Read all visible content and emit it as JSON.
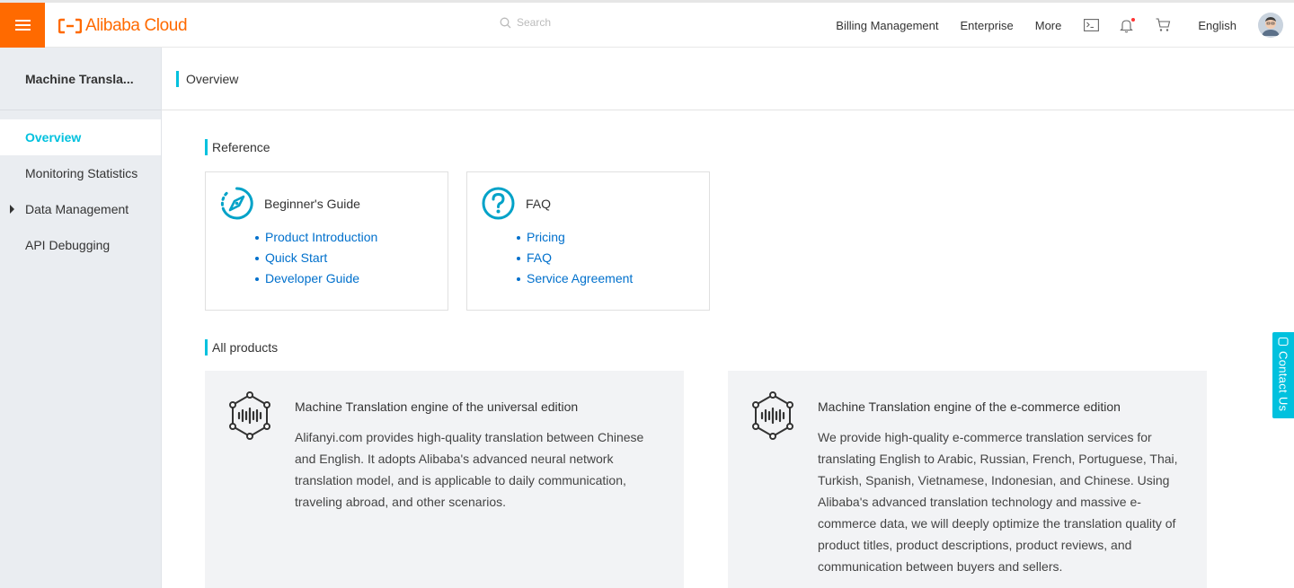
{
  "header": {
    "logo_text": "Alibaba Cloud",
    "search_placeholder": "Search",
    "links": [
      "Billing Management",
      "Enterprise",
      "More"
    ],
    "language": "English",
    "brand_color": "#ff6a00"
  },
  "sidebar": {
    "title": "Machine Transla...",
    "items": [
      {
        "label": "Overview",
        "active": true
      },
      {
        "label": "Monitoring Statistics"
      },
      {
        "label": "Data Management",
        "expandable": true
      },
      {
        "label": "API Debugging"
      }
    ]
  },
  "main": {
    "title": "Overview",
    "accent_color": "#00c1de",
    "reference": {
      "title": "Reference",
      "cards": [
        {
          "icon": "compass-icon",
          "title": "Beginner's Guide",
          "links": [
            "Product Introduction",
            "Quick Start",
            "Developer Guide"
          ]
        },
        {
          "icon": "question-circle-icon",
          "title": "FAQ",
          "links": [
            "Pricing",
            "FAQ",
            "Service Agreement"
          ]
        }
      ]
    },
    "products": {
      "title": "All products",
      "items": [
        {
          "icon": "translation-engine-icon",
          "title": "Machine Translation engine of the universal edition",
          "description": "Alifanyi.com provides high-quality translation between Chinese and English. It adopts Alibaba's advanced neural network translation model, and is applicable to daily communication, traveling abroad, and other scenarios."
        },
        {
          "icon": "translation-engine-icon",
          "title": "Machine Translation engine of the e-commerce edition",
          "description": "We provide high-quality e-commerce translation services for translating English to Arabic, Russian, French, Portuguese, Thai, Turkish, Spanish, Vietnamese, Indonesian, and Chinese. Using Alibaba's advanced translation technology and massive e-commerce data, we will deeply optimize the translation quality of product titles, product descriptions, product reviews, and communication between buyers and sellers."
        }
      ]
    }
  },
  "contact_tab": "Contact Us"
}
